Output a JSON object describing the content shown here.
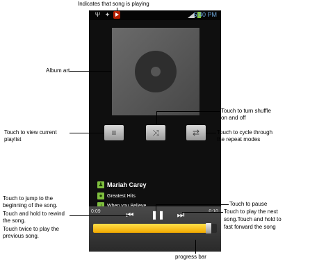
{
  "statusbar": {
    "time": "6:40 PM"
  },
  "now_playing": {
    "artist": "Mariah Carey",
    "album": "Greatest Hits",
    "song": "When you Believe",
    "elapsed": "0:09",
    "total": "0:10",
    "progress_percent": 93
  },
  "annotations": {
    "top": "Indicates that song is playing",
    "album_art": "Album art",
    "playlist": [
      "Touch to view current",
      "playlist"
    ],
    "shuffle": [
      "Touch to turn shuffle",
      "on and off"
    ],
    "repeat": [
      "Touch to cycle through",
      "the repeat modes"
    ],
    "rewind": [
      "Touch to jump to the",
      "beginning of the song.",
      "Touch and hold to rewind",
      "the song.",
      "Touch twice to play the",
      "previous song."
    ],
    "pause": "Touch to pause",
    "next": [
      "Touch to play the next",
      "song.Touch and hold to",
      "fast forward the song"
    ],
    "progress": "progress bar"
  },
  "icons": {
    "playlist": "playlist-icon",
    "shuffle": "shuffle-icon",
    "repeat": "repeat-icon",
    "prev": "previous-icon",
    "pause": "pause-icon",
    "next": "next-icon"
  },
  "colors": {
    "accent": "#7fbf3f",
    "progress": "#f2a900",
    "status_play": "#b41e00"
  }
}
